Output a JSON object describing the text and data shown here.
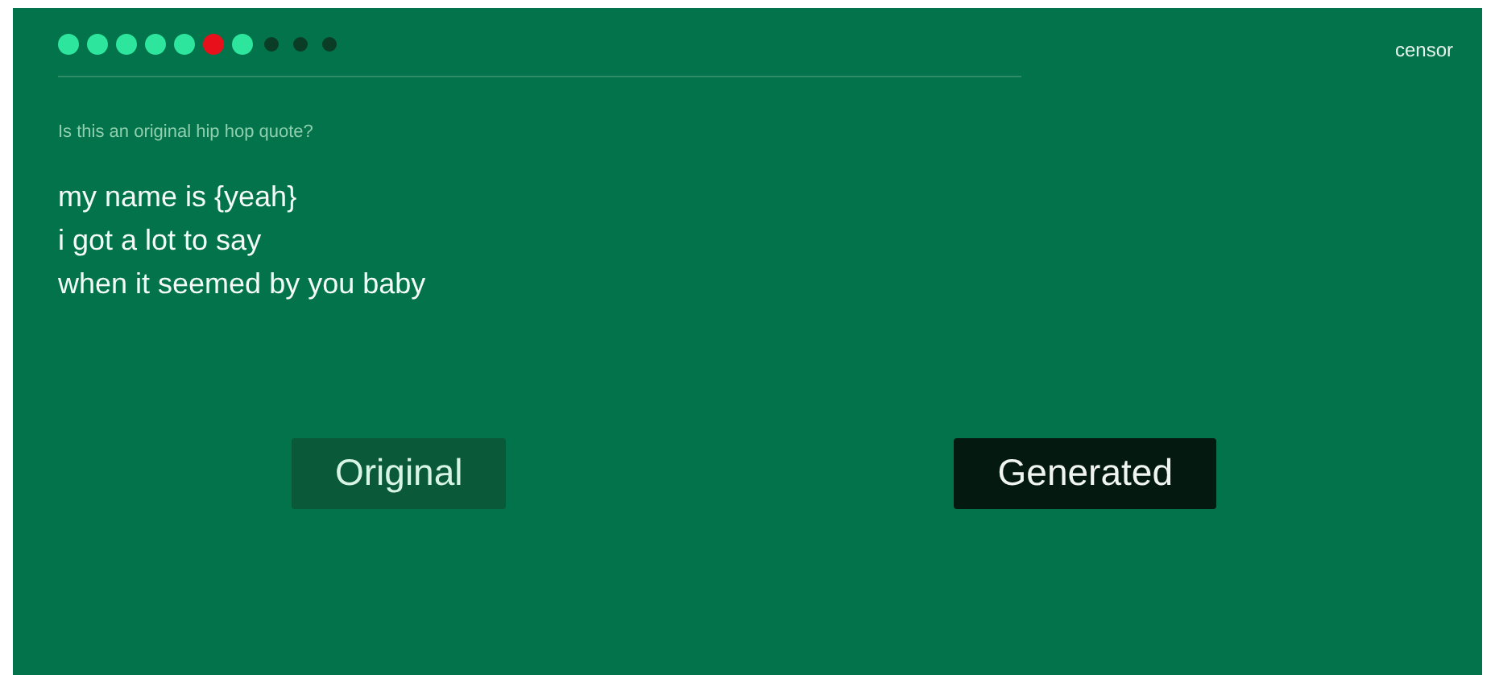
{
  "progress": [
    {
      "kind": "right"
    },
    {
      "kind": "right"
    },
    {
      "kind": "right"
    },
    {
      "kind": "right"
    },
    {
      "kind": "right"
    },
    {
      "kind": "wrong"
    },
    {
      "kind": "right"
    },
    {
      "kind": "pending"
    },
    {
      "kind": "pending"
    },
    {
      "kind": "pending"
    }
  ],
  "censor": "censor",
  "question": "Is this an original hip hop quote?",
  "quote_lines": [
    "my name is {yeah}",
    "i got a lot to say",
    "when it seemed by you baby"
  ],
  "buttons": [
    {
      "label": "Original",
      "kind": "muted"
    },
    {
      "label": "Generated",
      "kind": "dark"
    }
  ]
}
